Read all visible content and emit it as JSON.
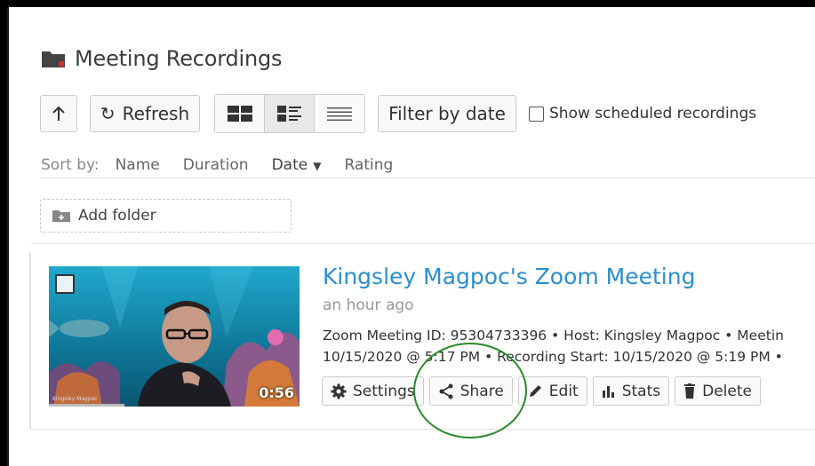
{
  "page": {
    "title": "Meeting Recordings",
    "folder_color": "#444444"
  },
  "toolbar": {
    "refresh_label": "Refresh",
    "filter_label": "Filter by date",
    "show_scheduled_label": "Show scheduled recordings",
    "view_modes": [
      "grid-view-icon",
      "detail-list-icon",
      "compact-list-icon"
    ],
    "active_view": "detail-list-icon"
  },
  "sort": {
    "label": "Sort by:",
    "options": [
      "Name",
      "Duration",
      "Date",
      "Rating"
    ],
    "active": "Date"
  },
  "add_folder_label": "Add folder",
  "recording": {
    "title": "Kingsley Magpoc's Zoom Meeting",
    "ago": "an hour ago",
    "meta_line1": "Zoom Meeting ID: 95304733396  • Host: Kingsley Magpoc  • Meetin",
    "meta_line2": "10/15/2020 @ 5:17 PM  • Recording Start: 10/15/2020 @ 5:19 PM  •",
    "duration": "0:56",
    "thumbnail_caption": "Kingsley Magpoc",
    "actions": {
      "settings": "Settings",
      "share": "Share",
      "edit": "Edit",
      "stats": "Stats",
      "delete": "Delete"
    }
  },
  "colors": {
    "title_link": "#2a8fd0",
    "highlight": "#2a8a2a"
  }
}
